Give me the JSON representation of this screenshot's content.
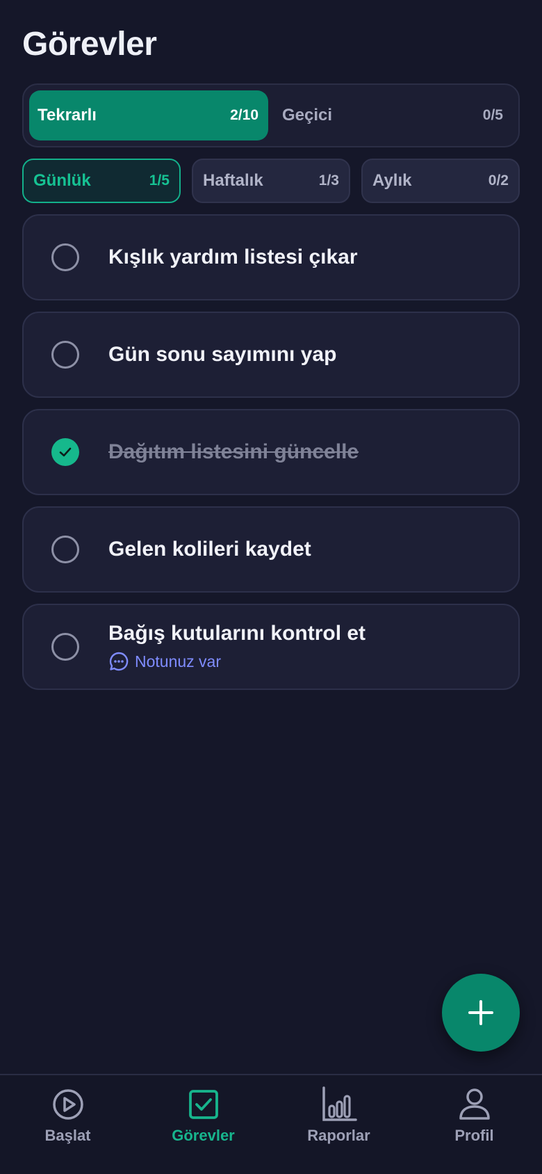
{
  "header": {
    "title": "Görevler"
  },
  "main_tabs": [
    {
      "label": "Tekrarlı",
      "count": "2/10"
    },
    {
      "label": "Geçici",
      "count": "0/5"
    }
  ],
  "period_tabs": [
    {
      "label": "Günlük",
      "count": "1/5"
    },
    {
      "label": "Haftalık",
      "count": "1/3"
    },
    {
      "label": "Aylık",
      "count": "0/2"
    }
  ],
  "tasks": [
    {
      "title": "Kışlık yardım listesi çıkar",
      "done": false
    },
    {
      "title": "Gün sonu sayımını yap",
      "done": false
    },
    {
      "title": "Dağıtım listesini güncelle",
      "done": true
    },
    {
      "title": "Gelen kolileri kaydet",
      "done": false
    },
    {
      "title": "Bağış kutularını kontrol et",
      "done": false,
      "note": "Notunuz var"
    }
  ],
  "fab": {
    "icon": "plus-icon"
  },
  "nav": [
    {
      "label": "Başlat",
      "icon": "play-icon"
    },
    {
      "label": "Görevler",
      "icon": "checkbox-icon"
    },
    {
      "label": "Raporlar",
      "icon": "bar-chart-icon"
    },
    {
      "label": "Profil",
      "icon": "user-icon"
    }
  ],
  "colors": {
    "background": "#151729",
    "accent": "#08876b",
    "accent_bright": "#16b88c",
    "note": "#7f8cff"
  }
}
